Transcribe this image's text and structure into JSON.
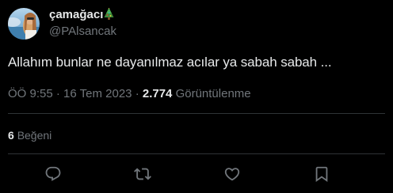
{
  "author": {
    "display_name": "çamağacı",
    "display_name_emoji": "christmas-tree-emoji",
    "handle": "@PAlsancak"
  },
  "tweet": {
    "text": "Allahım bunlar ne dayanılmaz acılar ya sabah sabah ..."
  },
  "meta": {
    "time": "ÖÖ 9:55",
    "separator": "·",
    "date": "16 Tem 2023",
    "views_count": "2.774",
    "views_label": "Görüntülenme"
  },
  "engagement": {
    "likes_count": "6",
    "likes_label": "Beğeni"
  },
  "actions": [
    {
      "icon": "reply-icon"
    },
    {
      "icon": "retweet-icon"
    },
    {
      "icon": "like-icon"
    },
    {
      "icon": "bookmark-icon"
    }
  ],
  "colors": {
    "background": "#000000",
    "primary_text": "#e7e9ea",
    "secondary_text": "#71767b",
    "divider": "#2f3336"
  }
}
